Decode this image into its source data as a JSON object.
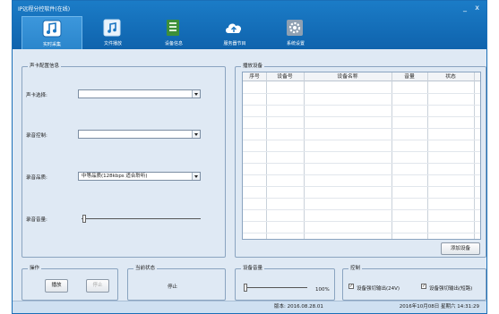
{
  "window": {
    "title": "IP远程分控软件(在线)",
    "minimize": "_",
    "close": "x"
  },
  "toolbar": {
    "items": [
      {
        "label": "实时采集",
        "icon": "music-note-icon",
        "active": true
      },
      {
        "label": "文件播放",
        "icon": "music-file-icon",
        "active": false
      },
      {
        "label": "设备信息",
        "icon": "book-icon",
        "active": false
      },
      {
        "label": "服务器节目",
        "icon": "cloud-upload-icon",
        "active": false
      },
      {
        "label": "系统设置",
        "icon": "gear-icon",
        "active": false
      }
    ]
  },
  "soundcard": {
    "title": "声卡配置信息",
    "card_label": "声卡选择:",
    "card_value": "",
    "record_label": "录音控制:",
    "record_value": "",
    "quality_label": "录音品质:",
    "quality_value": "中等品质(128kbps 适合聆听)",
    "volume_label": "录音音量:",
    "volume_level": 0.02
  },
  "operation": {
    "title": "操作",
    "play_label": "播放",
    "stop_label": "停止"
  },
  "current_state": {
    "title": "当前状态",
    "value": "停止"
  },
  "devices": {
    "title": "播放设备",
    "columns": [
      "序号",
      "设备号",
      "设备名称",
      "音量",
      "状态"
    ],
    "add_label": "添加设备"
  },
  "device_volume": {
    "title": "设备音量",
    "value": "100%",
    "level": 0.02
  },
  "control": {
    "title": "控制",
    "option1_label": "设备强切输出(24V)",
    "option1_checked": true,
    "option2_label": "设备强切输出(短路)",
    "option2_checked": true
  },
  "statusbar": {
    "version": "版本: 2016.08.28.01",
    "datetime": "2016年10月08日 星期六 14:31:29"
  }
}
